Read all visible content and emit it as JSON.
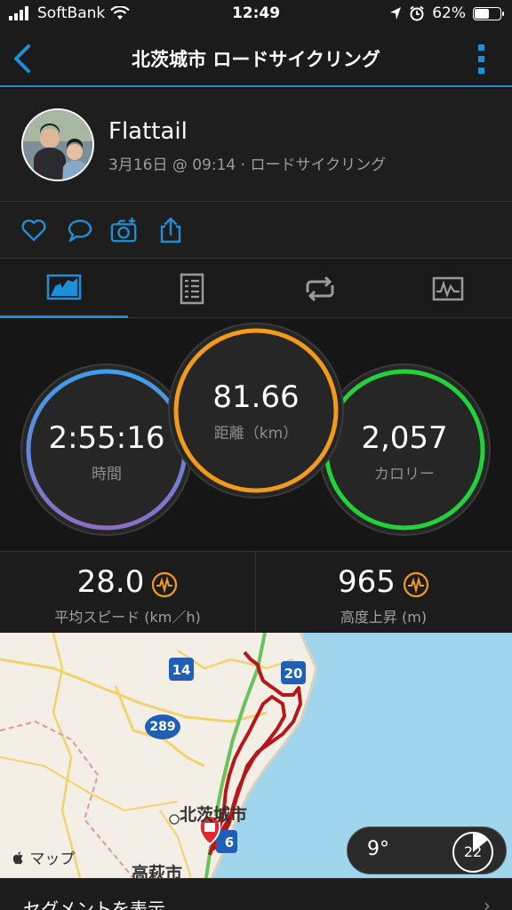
{
  "status_bar": {
    "carrier": "SoftBank",
    "time": "12:49",
    "battery": "62%",
    "battery_level": 0.62
  },
  "nav": {
    "title": "北茨城市 ロードサイクリング"
  },
  "activity": {
    "user_name": "Flattail",
    "subtitle": "3月16日 @ 09:14 · ロードサイクリング"
  },
  "rings": {
    "time_value": "2:55:16",
    "time_label": "時間",
    "distance_value": "81.66",
    "distance_label": "距離（km）",
    "calories_value": "2,057",
    "calories_label": "カロリー"
  },
  "metrics": {
    "speed_value": "28.0",
    "speed_label": "平均スピード (km／h)",
    "elevation_value": "965",
    "elevation_label": "高度上昇 (m)"
  },
  "map": {
    "maps_label": "マップ",
    "route_14": "14",
    "route_20": "20",
    "route_289": "289",
    "route_6": "6",
    "city_kitaibaraki": "北茨城市",
    "city_takahagi": "高萩市",
    "temperature": "9°",
    "wind": "22"
  },
  "segments": {
    "label": "セグメントを表示",
    "chevron": "›"
  },
  "colors": {
    "accent": "#1e8fd6",
    "time_ring": "#4f8fd9",
    "distance_ring": "#f39a1a",
    "calories_ring": "#23d13a",
    "route": "#c0151b"
  }
}
